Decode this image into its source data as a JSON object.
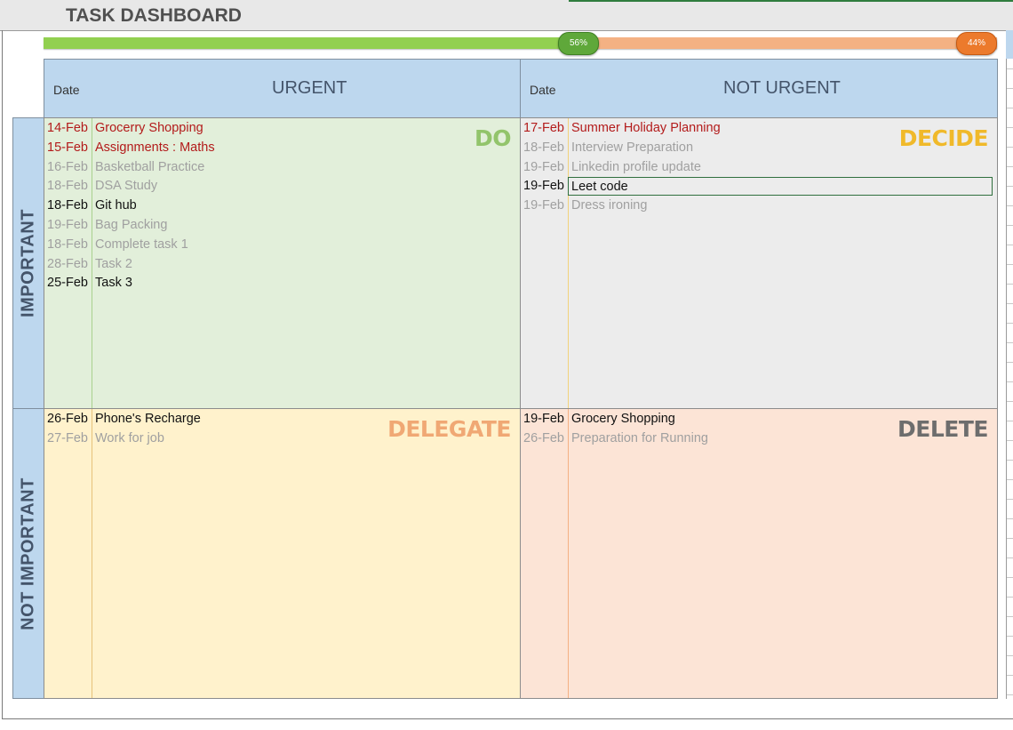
{
  "title": "TASK DASHBOARD",
  "progress": {
    "done_fraction": 0.56,
    "done_label": "56%",
    "remaining_label": "44%",
    "done_color": "#92d050",
    "remaining_color": "#f4b183"
  },
  "columns": {
    "date_label": "Date",
    "urgent": "URGENT",
    "not_urgent": "NOT URGENT"
  },
  "rows": {
    "important": "IMPORTANT",
    "not_important": "NOT IMPORTANT"
  },
  "quadrants": {
    "do": {
      "label": "DO",
      "label_color": "#92c46b",
      "bg": "#e2efda",
      "tasks": [
        {
          "date": "14-Feb",
          "task": "Grocerry Shopping",
          "status": "overdue"
        },
        {
          "date": "15-Feb",
          "task": "Assignments : Maths",
          "status": "overdue"
        },
        {
          "date": "16-Feb",
          "task": "Basketball Practice",
          "status": "done"
        },
        {
          "date": "18-Feb",
          "task": "DSA Study",
          "status": "done"
        },
        {
          "date": "18-Feb",
          "task": "Git hub",
          "status": "pending"
        },
        {
          "date": "19-Feb",
          "task": "Bag Packing",
          "status": "done"
        },
        {
          "date": "18-Feb",
          "task": "Complete task 1",
          "status": "done"
        },
        {
          "date": "28-Feb",
          "task": "Task 2",
          "status": "done"
        },
        {
          "date": "25-Feb",
          "task": "Task 3",
          "status": "pending"
        }
      ]
    },
    "decide": {
      "label": "DECIDE",
      "label_color": "#f0b92a",
      "bg": "#ececec",
      "tasks": [
        {
          "date": "17-Feb",
          "task": "Summer Holiday Planning",
          "status": "overdue"
        },
        {
          "date": "18-Feb",
          "task": "Interview Preparation",
          "status": "done"
        },
        {
          "date": "19-Feb",
          "task": "Linkedin profile update",
          "status": "done"
        },
        {
          "date": "19-Feb",
          "task": "Leet code",
          "status": "pending",
          "selected": true
        },
        {
          "date": "19-Feb",
          "task": "Dress ironing",
          "status": "done"
        }
      ]
    },
    "delegate": {
      "label": "DELEGATE",
      "label_color": "#f0a874",
      "bg": "#fff2cc",
      "tasks": [
        {
          "date": "26-Feb",
          "task": "Phone's Recharge",
          "status": "pending"
        },
        {
          "date": "27-Feb",
          "task": "Work for job",
          "status": "done"
        }
      ]
    },
    "delete": {
      "label": "DELETE",
      "label_color": "#6d6d6d",
      "bg": "#fce4d6",
      "tasks": [
        {
          "date": "19-Feb",
          "task": "Grocery Shopping",
          "status": "pending"
        },
        {
          "date": "26-Feb",
          "task": "Preparation for Running",
          "status": "done"
        }
      ]
    }
  }
}
